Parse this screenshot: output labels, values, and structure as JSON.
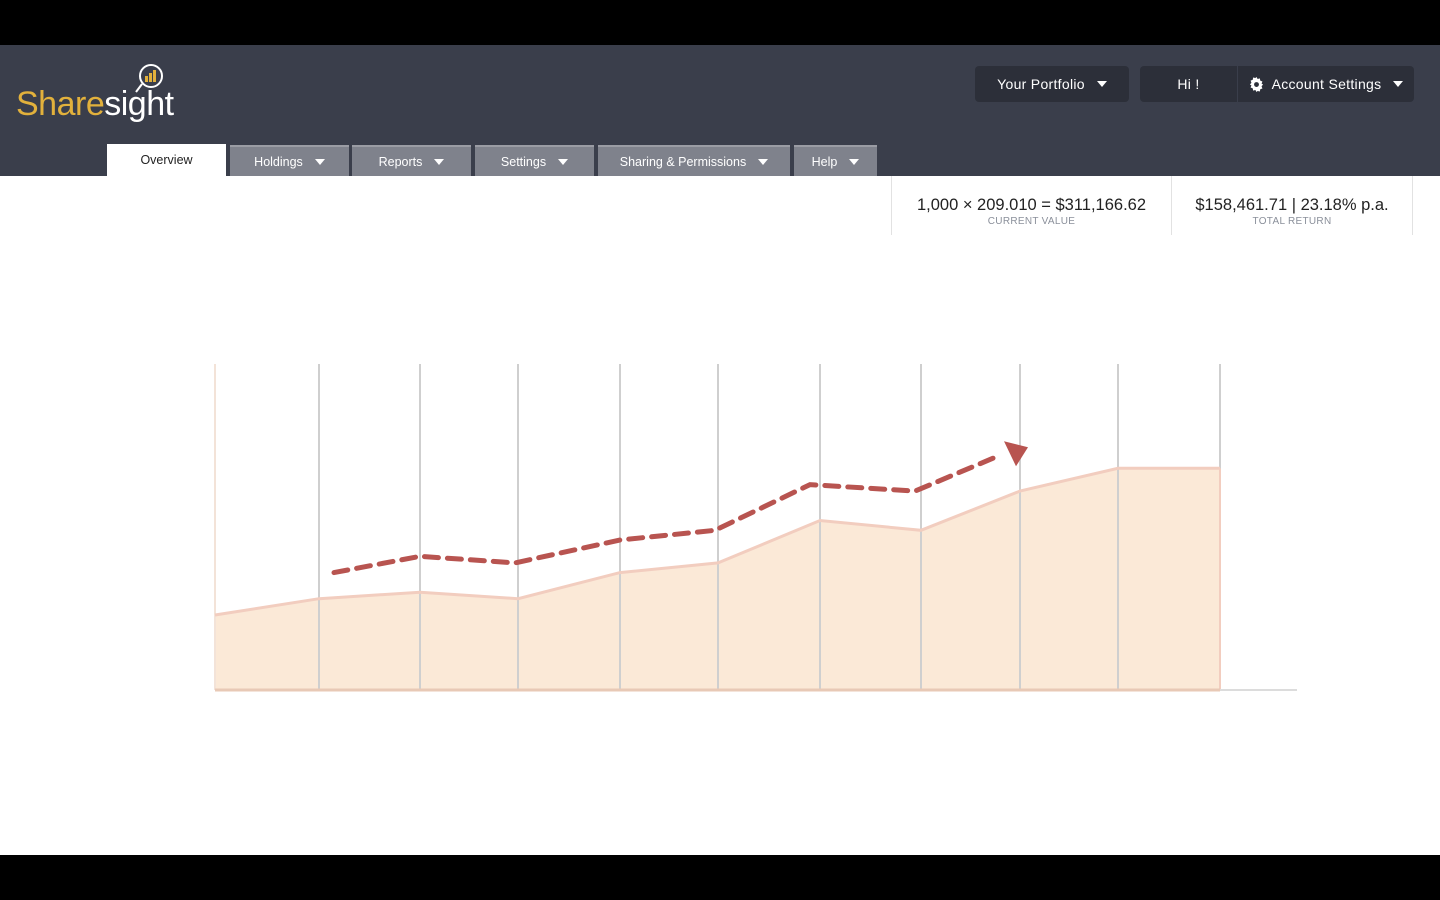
{
  "app": {
    "logo_part1": "Share",
    "logo_part2": "sight"
  },
  "topbar": {
    "portfolio_label": "Your Portfolio",
    "hi_label": "Hi !",
    "account_label": "Account Settings"
  },
  "tabs": [
    {
      "label": "Overview",
      "active": true
    },
    {
      "label": "Holdings",
      "dropdown": true
    },
    {
      "label": "Reports",
      "dropdown": true
    },
    {
      "label": "Settings",
      "dropdown": true
    },
    {
      "label": "Sharing & Permissions",
      "dropdown": true
    },
    {
      "label": "Help",
      "dropdown": true
    }
  ],
  "stats": {
    "current_value": "1,000 × 209.010 = $311,166.62",
    "current_value_label": "CURRENT VALUE",
    "total_return": "$158,461.71 | 23.18% p.a.",
    "total_return_label": "TOTAL RETURN"
  },
  "colors": {
    "header_bg": "#3a3e4b",
    "button_bg": "#2c2f39",
    "tab_bg": "#7f828c",
    "logo_gold": "#e2b13c",
    "area_fill": "#fbe9d7",
    "area_line": "#f2cdbf",
    "trend_line": "#b85450"
  },
  "icons": [
    "caret-down-icon",
    "gear-icon",
    "logo-chart-icon",
    "arrowhead-icon"
  ],
  "chart_data": {
    "type": "area",
    "grid": true,
    "series": [
      {
        "values": [
          23,
          28,
          30,
          28,
          36,
          39,
          52,
          49,
          61,
          68,
          68
        ]
      },
      {
        "values": [
          36,
          41,
          39,
          46,
          49,
          63,
          61,
          72
        ]
      }
    ],
    "ylim": [
      0,
      100
    ]
  }
}
